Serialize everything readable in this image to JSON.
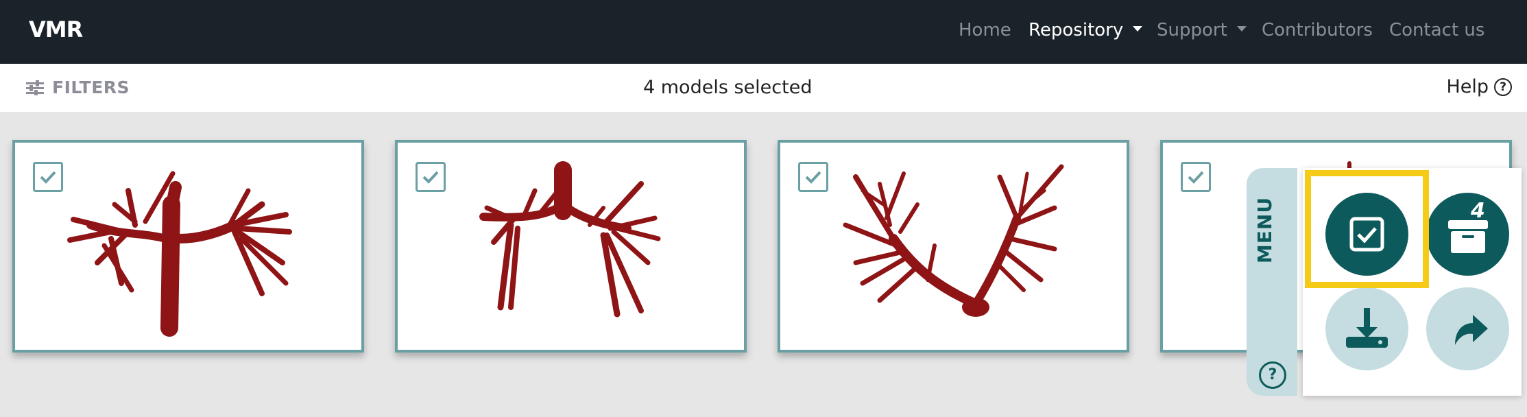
{
  "navbar": {
    "brand": "VMR",
    "items": [
      {
        "label": "Home",
        "active": false,
        "dropdown": false
      },
      {
        "label": "Repository",
        "active": true,
        "dropdown": true
      },
      {
        "label": "Support",
        "active": false,
        "dropdown": true
      },
      {
        "label": "Contributors",
        "active": false,
        "dropdown": false
      },
      {
        "label": "Contact us",
        "active": false,
        "dropdown": false
      }
    ]
  },
  "filterbar": {
    "filters_label": "FILTERS",
    "selected_text": "4 models selected",
    "help_label": "Help",
    "help_icon": "?"
  },
  "cards": [
    {
      "checked": true,
      "model_icon": "vascular-model-icon"
    },
    {
      "checked": true,
      "model_icon": "vascular-model-icon"
    },
    {
      "checked": true,
      "model_icon": "vascular-model-icon"
    },
    {
      "checked": true,
      "model_icon": "vascular-model-icon"
    }
  ],
  "menu": {
    "label": "MENU",
    "help_icon": "?",
    "buttons": [
      {
        "name": "select-all",
        "icon": "checkbox-icon",
        "style": "dark",
        "highlighted": true
      },
      {
        "name": "archive",
        "icon": "archive-box-icon",
        "style": "dark",
        "badge": "4"
      },
      {
        "name": "download",
        "icon": "download-icon",
        "style": "light"
      },
      {
        "name": "share",
        "icon": "share-arrow-icon",
        "style": "light"
      }
    ]
  },
  "colors": {
    "navbar_bg": "#1b232a",
    "accent": "#0d5a5c",
    "accent_light": "#c5dde1",
    "card_border": "#6a9fa3",
    "highlight": "#f6cb17",
    "model_red": "#8e1416"
  }
}
